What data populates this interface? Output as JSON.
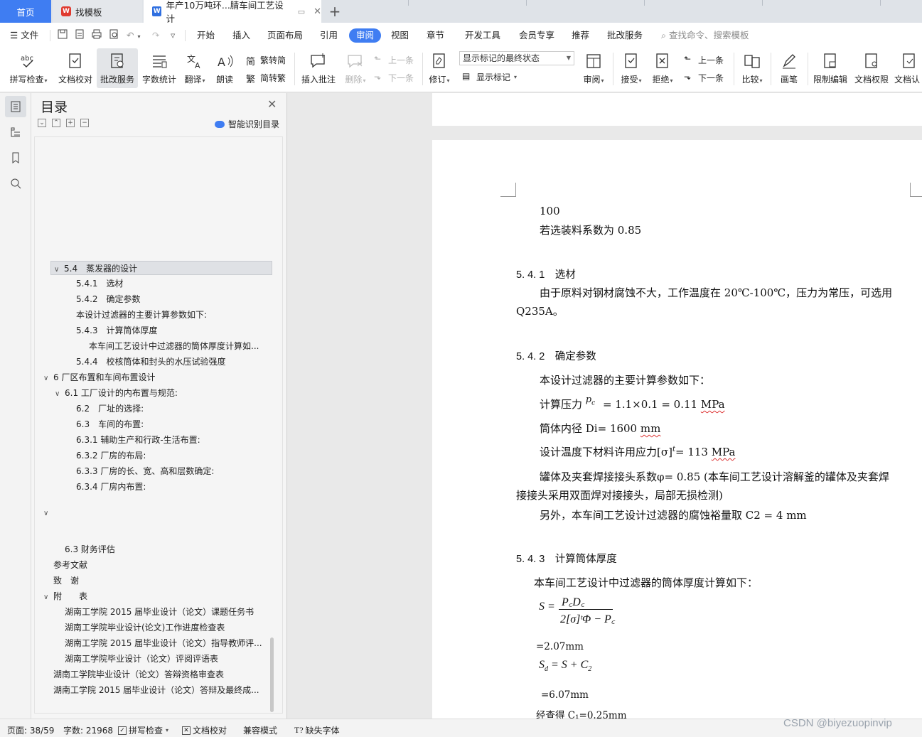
{
  "tabs": {
    "home": "首页",
    "template": "找模板",
    "document": "年产10万吨环...腈车间工艺设计",
    "add": "+"
  },
  "menu": {
    "file": "文件",
    "items": [
      "开始",
      "插入",
      "页面布局",
      "引用",
      "审阅",
      "视图",
      "章节",
      "开发工具",
      "会员专享",
      "推荐",
      "批改服务"
    ],
    "active": "审阅",
    "search": "查找命令、搜索模板"
  },
  "ribbon": {
    "spell": "拼写检查",
    "doc_check": "文档校对",
    "review_service": "批改服务",
    "word_count": "字数统计",
    "translate": "翻译",
    "read_aloud": "朗读",
    "trad_to_simp": "繁转简",
    "simp_to_trad": "简转繁",
    "insert_comment": "插入批注",
    "delete": "删除",
    "prev_comment": "上一条",
    "next_comment": "下一条",
    "track": "修订",
    "markup_state": "显示标记的最终状态",
    "show_markup": "显示标记",
    "review": "审阅",
    "accept": "接受",
    "reject": "拒绝",
    "prev_change": "上一条",
    "next_change": "下一条",
    "compare": "比较",
    "pen": "画笔",
    "restrict_edit": "限制编辑",
    "doc_permission": "文档权限",
    "doc_auth": "文档认"
  },
  "toc": {
    "title": "目录",
    "smart": "智能识别目录",
    "items": [
      {
        "text": "5.4　蒸发器的设计",
        "chev": "∨",
        "selected": true
      },
      {
        "text": "5.4.1　选材"
      },
      {
        "text": "5.4.2　确定参数"
      },
      {
        "text": "本设计过滤器的主要计算参数如下:"
      },
      {
        "text": "5.4.3　计算筒体厚度"
      },
      {
        "text": "本车间工艺设计中过滤器的筒体厚度计算如..."
      },
      {
        "text": "5.4.4　校核筒体和封头的水压试验强度"
      },
      {
        "text": "6 厂区布置和车间布置设计",
        "chev": "∨"
      },
      {
        "text": "6.1 工厂设计的内布置与规范:",
        "chev": "∨"
      },
      {
        "text": "6.2　厂址的选择:"
      },
      {
        "text": "6.3　车间的布置:"
      },
      {
        "text": "6.3.1  辅助生产和行政-生活布置:"
      },
      {
        "text": "6.3.2  厂房的布局:"
      },
      {
        "text": "6.3.3  厂房的长、宽、高和层数确定:"
      },
      {
        "text": "6.3.4  厂房内布置:"
      },
      {
        "text": "",
        "chev": "∨"
      },
      {
        "text": "6.3 财务评估"
      },
      {
        "text": "参考文献"
      },
      {
        "text": "致　谢"
      },
      {
        "text": "附　　表",
        "chev": "∨"
      },
      {
        "text": "湖南工学院 2015 届毕业设计（论文）课题任务书"
      },
      {
        "text": "湖南工学院毕业设计(论文)工作进度检查表"
      },
      {
        "text": "湖南工学院 2015 届毕业设计（论文）指导教师评..."
      },
      {
        "text": "湖南工学院毕业设计（论文）评阅评语表"
      },
      {
        "text": "湖南工学院毕业设计（论文）答辩资格审查表"
      },
      {
        "text": "湖南工学院 2015 届毕业设计（论文）答辩及最终成..."
      }
    ]
  },
  "doc": {
    "l1": "100",
    "l2": "若选装料系数为 0.85",
    "h541": "5. 4. 1　选材",
    "p541a": "由于原料对钢材腐蚀不大，工作温度在 20℃-100℃，压力为常压，可选用",
    "p541b": "Q235A。",
    "h542": "5. 4. 2　确定参数",
    "p542": "本设计过滤器的主要计算参数如下：",
    "calc_label": "计算压力",
    "calc_sym": "p",
    "calc_sub": "c",
    "calc_val": "= 1.1×0.1 = 0.11 ",
    "calc_unit": "MPa",
    "di_label": "筒体内径 Di= 1600 ",
    "di_unit": "mm",
    "stress_label": "设计温度下材料许用应力[σ]",
    "stress_sup": "t",
    "stress_val": "= 113 ",
    "stress_unit": "MPa",
    "weld_a": "罐体及夹套焊接接头系数φ= 0.85 (本车间工艺设计溶解釜的罐体及夹套焊",
    "weld_b": "接接头采用双面焊对接接头，局部无损检测)",
    "corr": "另外，本车间工艺设计过滤器的腐蚀裕量取 C2 = 4 mm",
    "h543": "5. 4. 3　计算筒体厚度",
    "p543": "本车间工艺设计中过滤器的筒体厚度计算如下：",
    "f_lhs": "S =",
    "f_num": "P꜀D꜀",
    "f_den": "2[σ]ᵗΦ − P꜀",
    "r1": "=2.07mm",
    "f2": "S",
    "f2_sub": "d",
    "f2_rhs": " = S + C",
    "f2_sub2": "2",
    "r2": "=6.07mm",
    "last": "经查得 C₁=0.25mm"
  },
  "status": {
    "page": "页面: 38/59",
    "words": "字数: 21968",
    "spell": "拼写检查",
    "check": "文档校对",
    "compat": "兼容模式",
    "font": "缺失字体"
  },
  "watermark": "CSDN @biyezuopinvip"
}
